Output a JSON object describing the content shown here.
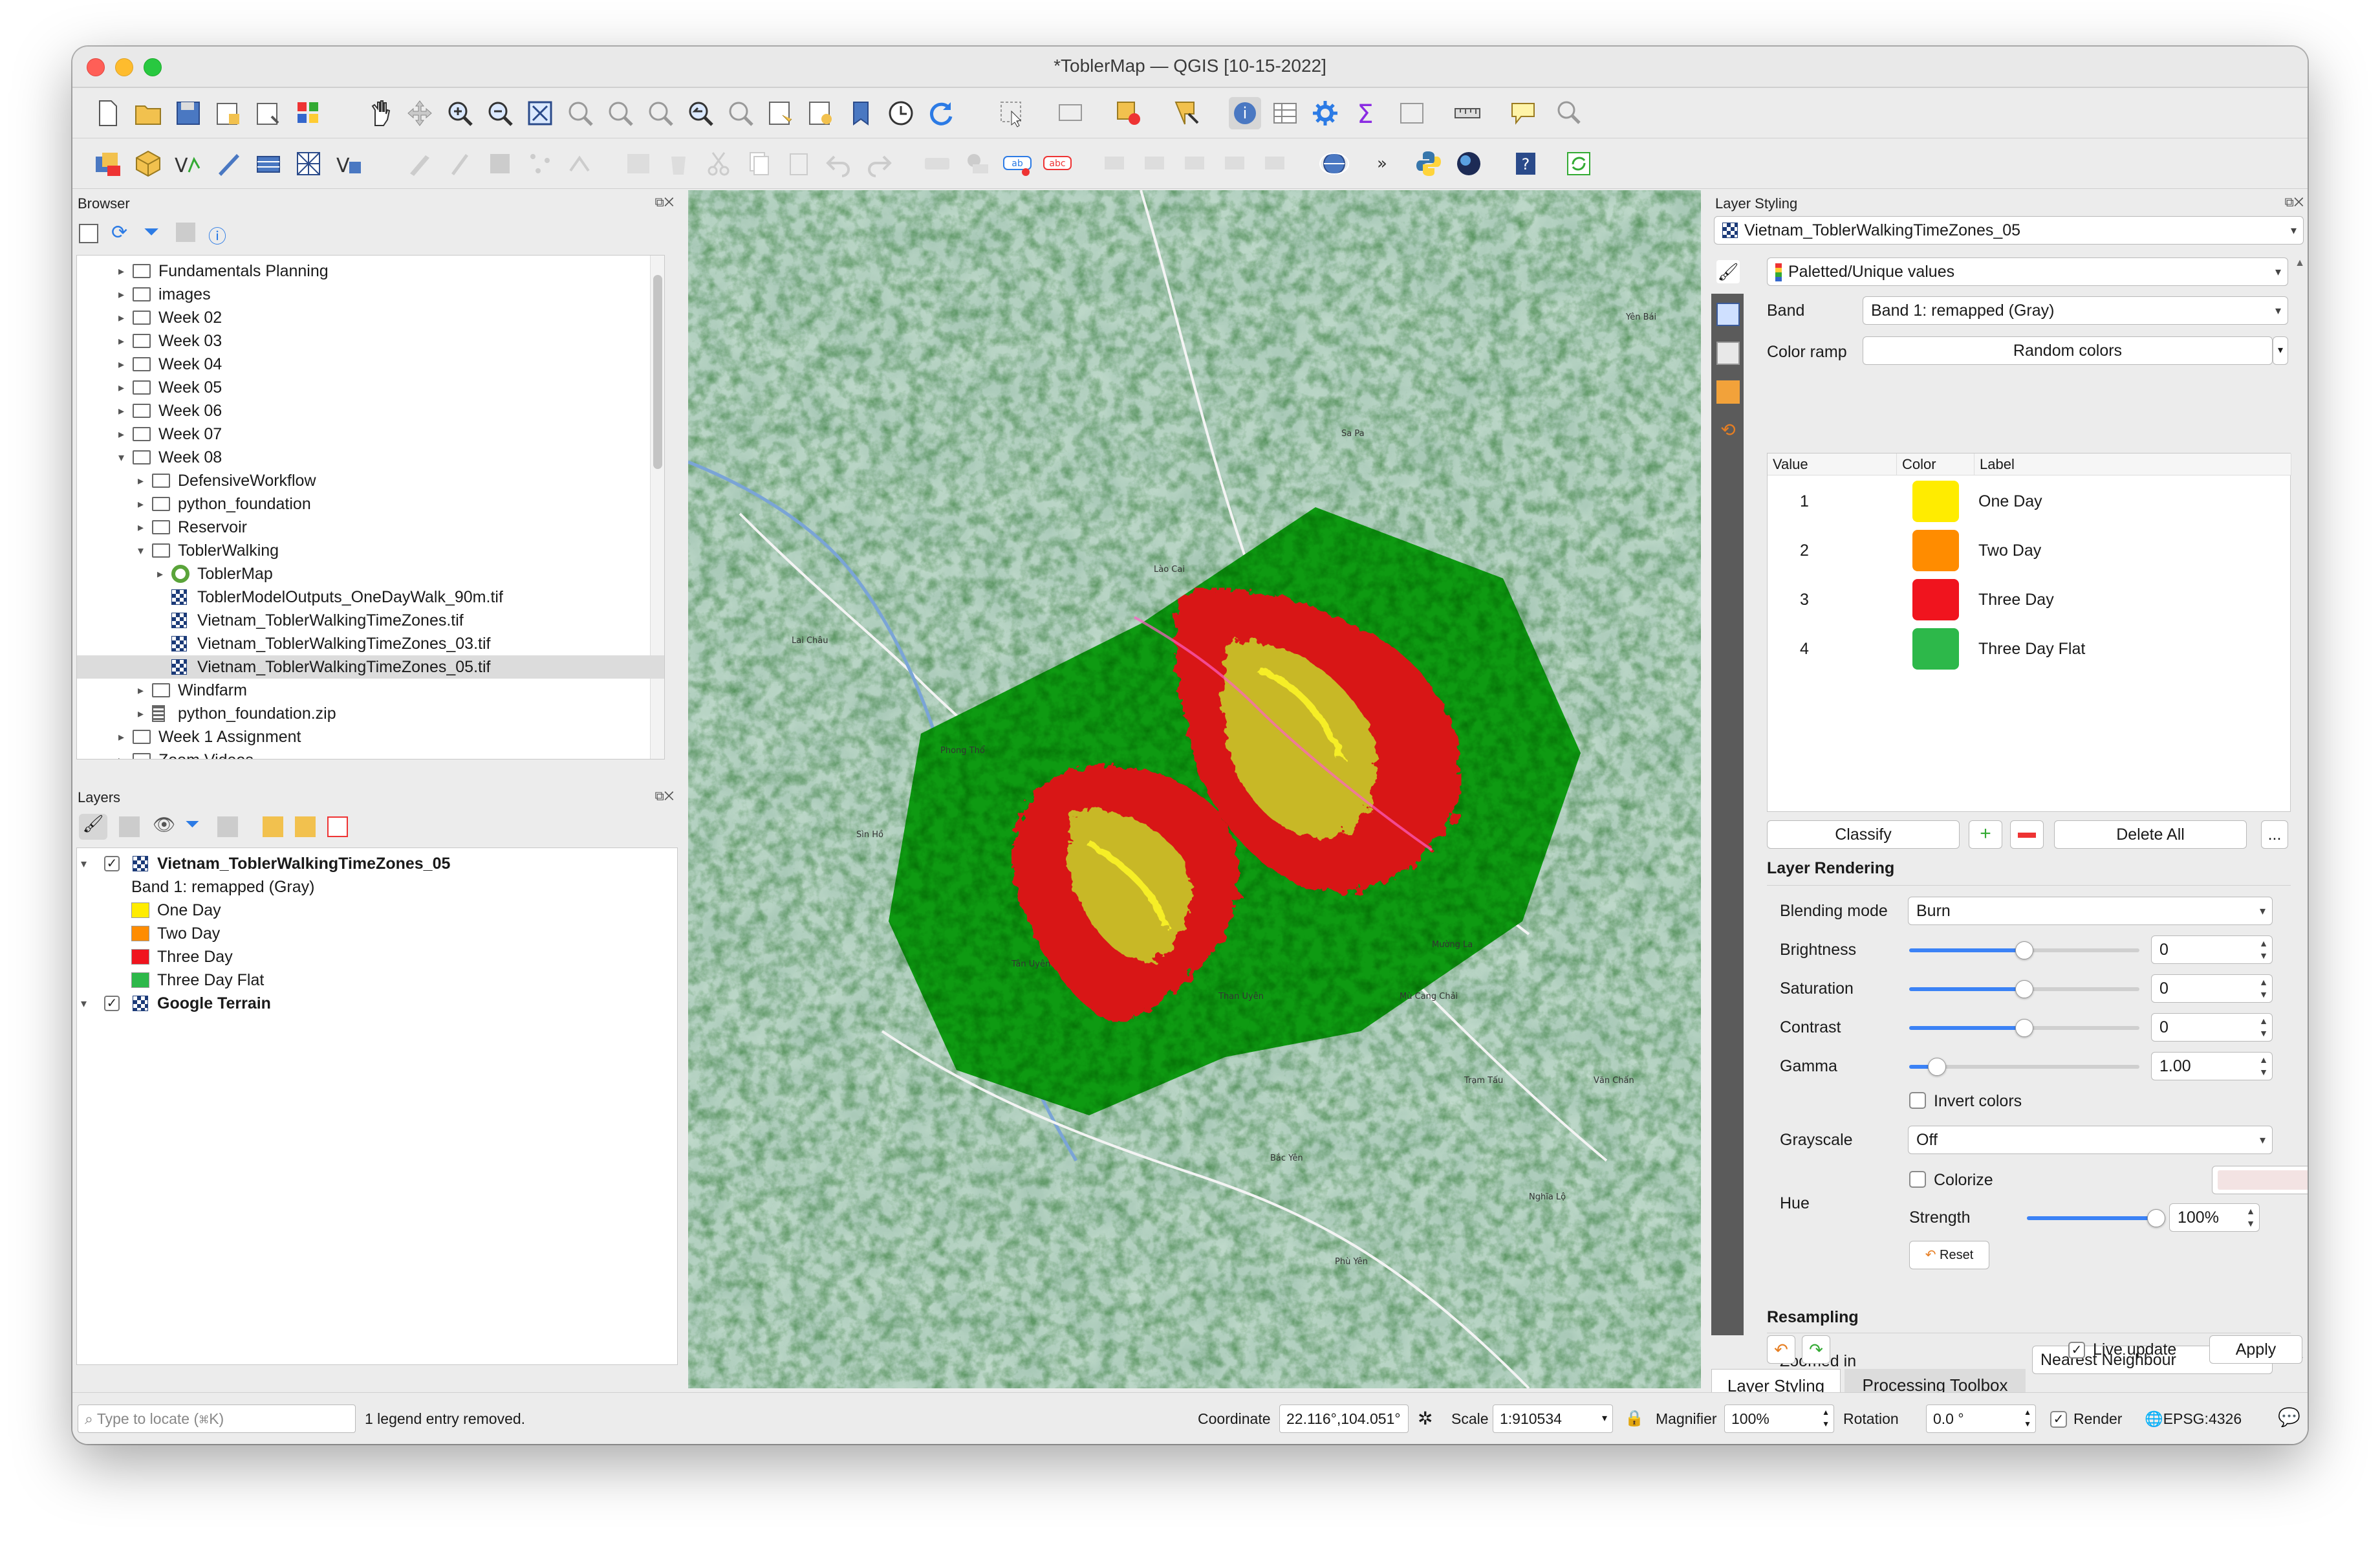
{
  "window": {
    "title": "*ToblerMap — QGIS [10-15-2022]"
  },
  "browser": {
    "title": "Browser",
    "items": [
      {
        "label": "Fundamentals Planning",
        "type": "folder",
        "depth": 1,
        "arrow": "▸"
      },
      {
        "label": "images",
        "type": "folder",
        "depth": 1,
        "arrow": "▸"
      },
      {
        "label": "Week 02",
        "type": "folder",
        "depth": 1,
        "arrow": "▸"
      },
      {
        "label": "Week 03",
        "type": "folder",
        "depth": 1,
        "arrow": "▸"
      },
      {
        "label": "Week 04",
        "type": "folder",
        "depth": 1,
        "arrow": "▸"
      },
      {
        "label": "Week 05",
        "type": "folder",
        "depth": 1,
        "arrow": "▸"
      },
      {
        "label": "Week 06",
        "type": "folder",
        "depth": 1,
        "arrow": "▸"
      },
      {
        "label": "Week 07",
        "type": "folder",
        "depth": 1,
        "arrow": "▸"
      },
      {
        "label": "Week 08",
        "type": "folder",
        "depth": 1,
        "arrow": "▾"
      },
      {
        "label": "DefensiveWorkflow",
        "type": "folder",
        "depth": 2,
        "arrow": "▸"
      },
      {
        "label": "python_foundation",
        "type": "folder",
        "depth": 2,
        "arrow": "▸"
      },
      {
        "label": "Reservoir",
        "type": "folder",
        "depth": 2,
        "arrow": "▸"
      },
      {
        "label": "ToblerWalking",
        "type": "folder",
        "depth": 2,
        "arrow": "▾"
      },
      {
        "label": "ToblerMap",
        "type": "qgis",
        "depth": 3,
        "arrow": "▸"
      },
      {
        "label": "ToblerModelOutputs_OneDayWalk_90m.tif",
        "type": "raster",
        "depth": 3,
        "arrow": ""
      },
      {
        "label": "Vietnam_ToblerWalkingTimeZones.tif",
        "type": "raster",
        "depth": 3,
        "arrow": ""
      },
      {
        "label": "Vietnam_ToblerWalkingTimeZones_03.tif",
        "type": "raster",
        "depth": 3,
        "arrow": ""
      },
      {
        "label": "Vietnam_ToblerWalkingTimeZones_05.tif",
        "type": "raster",
        "depth": 3,
        "arrow": "",
        "selected": true
      },
      {
        "label": "Windfarm",
        "type": "folder",
        "depth": 2,
        "arrow": "▸"
      },
      {
        "label": "python_foundation.zip",
        "type": "zip",
        "depth": 2,
        "arrow": "▸"
      },
      {
        "label": "Week 1 Assignment",
        "type": "folder",
        "depth": 1,
        "arrow": "▸"
      },
      {
        "label": "Zoom Videos",
        "type": "folder",
        "depth": 1,
        "arrow": "▸"
      }
    ]
  },
  "layers": {
    "title": "Layers",
    "layer1": {
      "name": "Vietnam_ToblerWalkingTimeZones_05",
      "band": "Band 1: remapped (Gray)"
    },
    "legend": [
      {
        "label": "One Day",
        "color": "#ffec00"
      },
      {
        "label": "Two Day",
        "color": "#ff8c00"
      },
      {
        "label": "Three Day",
        "color": "#f0141e"
      },
      {
        "label": "Three Day Flat",
        "color": "#2db84a"
      }
    ],
    "layer2": {
      "name": "Google Terrain"
    }
  },
  "map_labels": [
    "Lai Châu",
    "Phong Thổ",
    "Sìn Hồ",
    "Sa Pa",
    "Lào Cai",
    "Nghĩa Lộ",
    "Mường La",
    "Phù Yên",
    "Văn Chấn",
    "Yên Bái",
    "Bắc Yên",
    "Tân Uyên",
    "Than Uyên",
    "Mù Cang Chải",
    "Trạm Tấu"
  ],
  "styling": {
    "title": "Layer Styling",
    "layer": "Vietnam_ToblerWalkingTimeZones_05",
    "renderer": "Paletted/Unique values",
    "band_label": "Band",
    "band_value": "Band 1: remapped (Gray)",
    "ramp_label": "Color ramp",
    "ramp_value": "Random colors",
    "cols": {
      "value": "Value",
      "color": "Color",
      "label": "Label"
    },
    "classes": [
      {
        "value": "1",
        "color": "#ffec00",
        "label": "One Day"
      },
      {
        "value": "2",
        "color": "#ff8c00",
        "label": "Two Day"
      },
      {
        "value": "3",
        "color": "#f0141e",
        "label": "Three Day"
      },
      {
        "value": "4",
        "color": "#2db84a",
        "label": "Three Day Flat"
      }
    ],
    "classify": "Classify",
    "delete_all": "Delete All",
    "more": "...",
    "rendering_title": "Layer Rendering",
    "blending_label": "Blending mode",
    "blending_value": "Burn",
    "brightness_label": "Brightness",
    "brightness_value": "0",
    "brightness_level": 0.5,
    "saturation_label": "Saturation",
    "saturation_value": "0",
    "saturation_level": 0.5,
    "contrast_label": "Contrast",
    "contrast_value": "0",
    "contrast_level": 0.5,
    "gamma_label": "Gamma",
    "gamma_value": "1.00",
    "gamma_level": 0.12,
    "invert_label": "Invert colors",
    "grayscale_label": "Grayscale",
    "grayscale_value": "Off",
    "hue_label": "Hue",
    "colorize_label": "Colorize",
    "strength_label": "Strength",
    "strength_value": "100%",
    "strength_level": 1.0,
    "reset": "Reset",
    "resampling_title": "Resampling",
    "zoomed_in_label": "Zoomed in",
    "zoomed_in_value": "Nearest Neighbour",
    "live_update": "Live update",
    "apply": "Apply",
    "tab1": "Layer Styling",
    "tab2": "Processing Toolbox"
  },
  "status": {
    "locate_placeholder": "Type to locate (⌘K)",
    "message": "1 legend entry removed.",
    "coordinate_label": "Coordinate",
    "coordinate_value": "22.116°,104.051°",
    "scale_label": "Scale",
    "scale_value": "1:910534",
    "magnifier_label": "Magnifier",
    "magnifier_value": "100%",
    "rotation_label": "Rotation",
    "rotation_value": "0.0 °",
    "render_label": "Render",
    "crs": "EPSG:4326"
  }
}
